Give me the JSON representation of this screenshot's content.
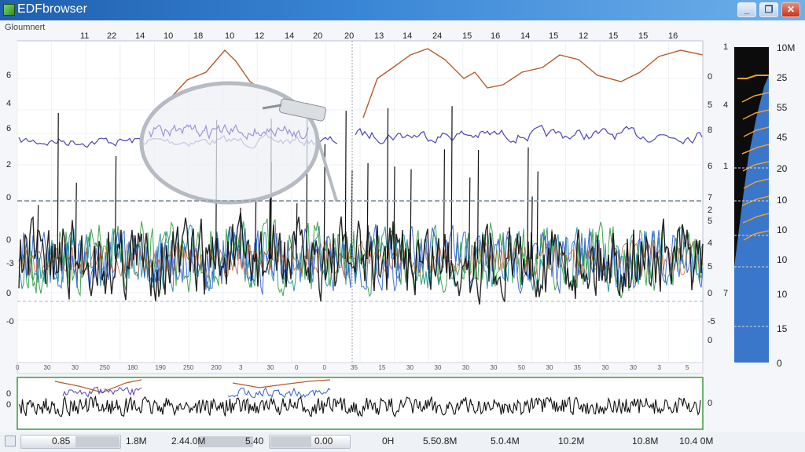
{
  "window": {
    "title": "EDFbrowser",
    "minimize_label": "_",
    "maximize_label": "❐",
    "close_label": "✕"
  },
  "channel_label": "Gloumnert",
  "top_time_ticks": [
    "11",
    "22",
    "14",
    "10",
    "18",
    "10",
    "12",
    "14",
    "20",
    "20",
    "13",
    "14",
    "24",
    "15",
    "16",
    "14",
    "15",
    "12",
    "15",
    "15",
    "16"
  ],
  "left_axis_labels": [
    "6",
    "4",
    "6",
    "2",
    "0",
    "0",
    "-3",
    "0",
    "-0"
  ],
  "right_inner_labels": [
    "1",
    "0",
    "5",
    "4",
    "8",
    "6",
    "1",
    "7",
    "2",
    "5",
    "4",
    "5",
    "0",
    "7",
    "-5",
    "0"
  ],
  "right_scale_labels": [
    "10M",
    "25",
    "55",
    "45",
    "20",
    "10",
    "10",
    "10",
    "10",
    "15",
    "0"
  ],
  "mini_ticks": [
    "0",
    "30",
    "30",
    "250",
    "180",
    "190",
    "250",
    "200",
    "3",
    "30",
    "0",
    "0",
    "35",
    "15",
    "30",
    "30",
    "30",
    "30",
    "50",
    "30",
    "35",
    "30",
    "30",
    "3",
    "5"
  ],
  "overview": {
    "left_labels": [
      "0",
      "0"
    ],
    "right_label": "0"
  },
  "bottom_time_labels": [
    "0.85",
    "1.8M",
    "2.44.0M",
    "5.40",
    "0.00",
    "0H",
    "5.50.8M",
    "5.0.4M",
    "10.2M",
    "10.8M",
    "10.4 0M"
  ],
  "colors": {
    "titlebar": "#2f73c4",
    "trace_orange": "#b85a2a",
    "trace_purple": "#4f45b5",
    "trace_black": "#111111",
    "trace_teal": "#178a9a",
    "trace_green": "#2f9a3e",
    "trace_blue": "#2f5fcf",
    "scale_bg": "#101010",
    "scale_fill": "#3a76c9",
    "scale_orange": "#f0a02b",
    "overview_border": "#3c9a3c"
  },
  "icons": [
    "app-icon",
    "minimize-icon",
    "maximize-icon",
    "close-icon",
    "magnifier-icon",
    "nav-icon"
  ]
}
